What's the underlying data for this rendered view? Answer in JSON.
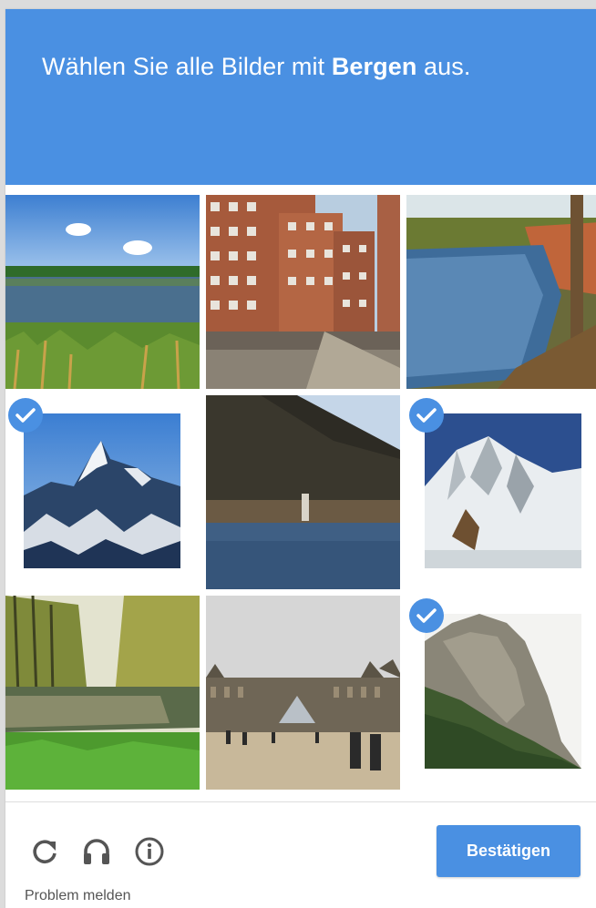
{
  "header": {
    "prompt_prefix": "Wählen Sie alle Bilder mit ",
    "prompt_keyword": "Bergen",
    "prompt_suffix": " aus.",
    "bg_color": "#4a90e2"
  },
  "tiles": [
    {
      "scene": "lake-meadow",
      "selected": false
    },
    {
      "scene": "apartment-building",
      "selected": false
    },
    {
      "scene": "pond-autumn-tree",
      "selected": false
    },
    {
      "scene": "snowy-jagged-peaks",
      "selected": true
    },
    {
      "scene": "hill-lake-lighthouse",
      "selected": false
    },
    {
      "scene": "snowy-mountain-hut",
      "selected": true
    },
    {
      "scene": "river-spring-trees",
      "selected": false
    },
    {
      "scene": "louvre-courtyard",
      "selected": false
    },
    {
      "scene": "rocky-cliff",
      "selected": true
    }
  ],
  "footer": {
    "icons": [
      "reload-icon",
      "headphones-icon",
      "info-icon"
    ],
    "report_label": "Problem melden",
    "verify_label": "Bestätigen"
  },
  "colors": {
    "accent": "#4a90e2",
    "check": "#4a90e2"
  }
}
